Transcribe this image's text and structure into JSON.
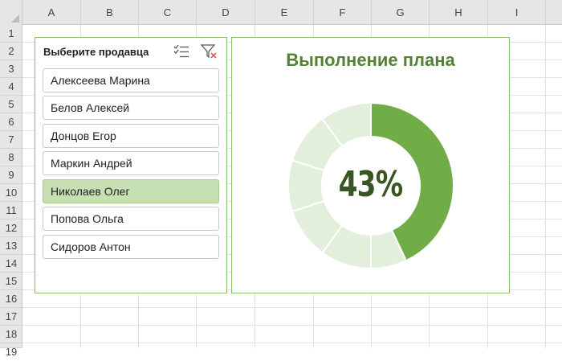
{
  "sheet": {
    "columns": [
      "A",
      "B",
      "C",
      "D",
      "E",
      "F",
      "G",
      "H",
      "I"
    ],
    "rows": [
      "1",
      "2",
      "3",
      "4",
      "5",
      "6",
      "7",
      "8",
      "9",
      "10",
      "11",
      "12",
      "13",
      "14",
      "15",
      "16",
      "17",
      "18",
      "19"
    ]
  },
  "slicer": {
    "title": "Выберите продавца",
    "multiselect_icon": "multi-select-icon",
    "clear_filter_icon": "clear-filter-icon",
    "items": [
      {
        "label": "Алексеева Марина",
        "selected": false
      },
      {
        "label": "Белов Алексей",
        "selected": false
      },
      {
        "label": "Донцов Егор",
        "selected": false
      },
      {
        "label": "Маркин Андрей",
        "selected": false
      },
      {
        "label": "Николаев Олег",
        "selected": true
      },
      {
        "label": "Попова Ольга",
        "selected": false
      },
      {
        "label": "Сидоров Антон",
        "selected": false
      }
    ]
  },
  "chart": {
    "title": "Выполнение плана",
    "center_label": "43%"
  },
  "chart_data": {
    "type": "pie",
    "title": "Выполнение плана",
    "donut": true,
    "segments_total": 10,
    "value_percent": 43,
    "colors": {
      "filled": "#70ad47",
      "remaining": "#e2efda"
    }
  }
}
